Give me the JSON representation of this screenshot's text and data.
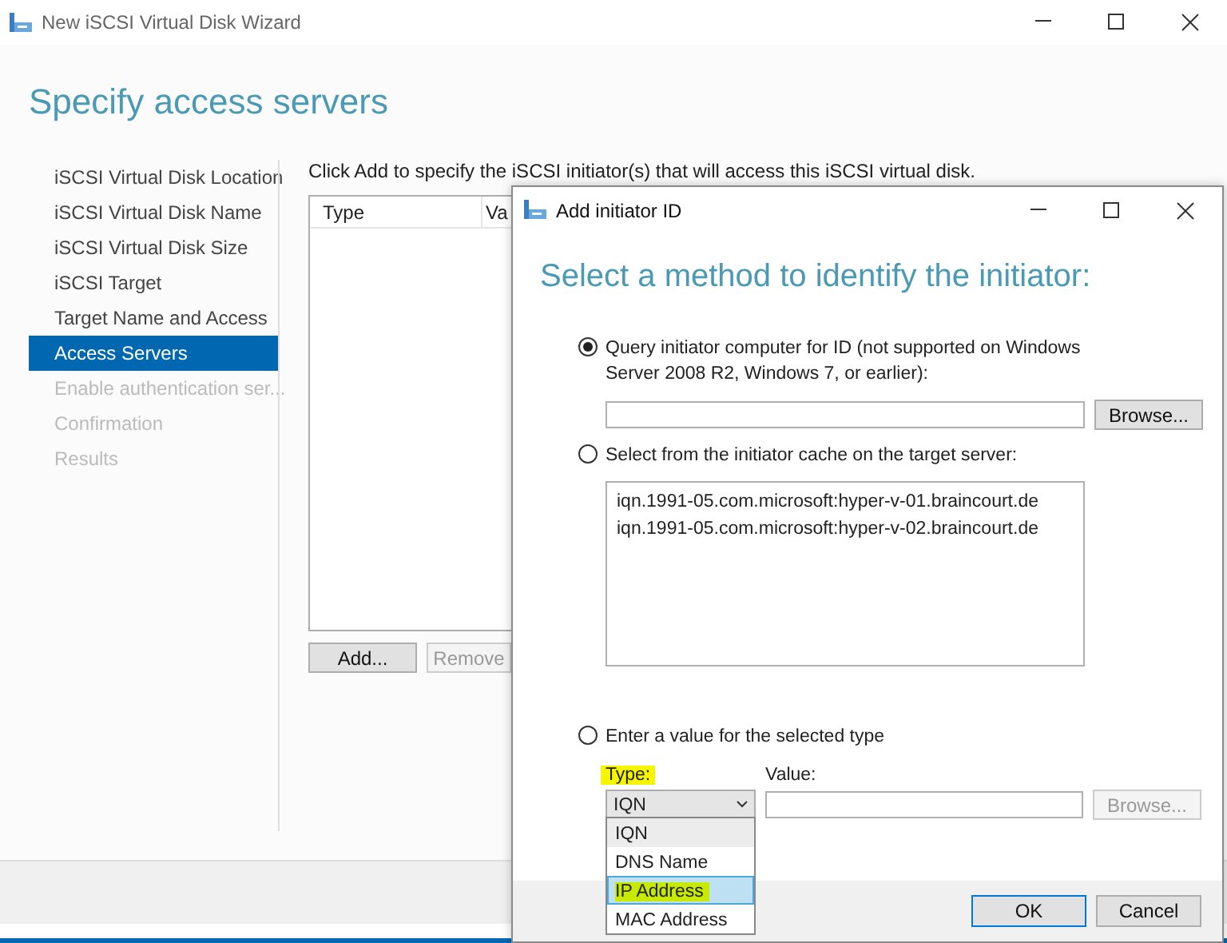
{
  "wizard": {
    "title": "New iSCSI Virtual Disk Wizard",
    "heading": "Specify access servers",
    "steps": [
      {
        "label": "iSCSI Virtual Disk Location",
        "selected": false,
        "disabled": false
      },
      {
        "label": "iSCSI Virtual Disk Name",
        "selected": false,
        "disabled": false
      },
      {
        "label": "iSCSI Virtual Disk Size",
        "selected": false,
        "disabled": false
      },
      {
        "label": "iSCSI Target",
        "selected": false,
        "disabled": false
      },
      {
        "label": "Target Name and Access",
        "selected": false,
        "disabled": false
      },
      {
        "label": "Access Servers",
        "selected": true,
        "disabled": false
      },
      {
        "label": "Enable authentication ser...",
        "selected": false,
        "disabled": true
      },
      {
        "label": "Confirmation",
        "selected": false,
        "disabled": true
      },
      {
        "label": "Results",
        "selected": false,
        "disabled": true
      }
    ],
    "instruction": "Click Add to specify the iSCSI initiator(s) that will access this iSCSI virtual disk.",
    "table": {
      "columns": [
        "Type",
        "Va"
      ]
    },
    "buttons": [
      {
        "label": "Add...",
        "disabled": false
      },
      {
        "label": "Remove",
        "disabled": true
      }
    ]
  },
  "dialog": {
    "title": "Add initiator ID",
    "heading": "Select a method to identify the initiator:",
    "options": [
      {
        "kind": "query",
        "label": "Query initiator computer for ID (not supported on Windows Server 2008 R2, Windows 7, or earlier):",
        "selected": true,
        "browse": {
          "label": "Browse...",
          "disabled": false
        }
      },
      {
        "kind": "cache",
        "label": "Select from the initiator cache on the target server:",
        "selected": false,
        "items": [
          "iqn.1991-05.com.microsoft:hyper-v-01.braincourt.de",
          "iqn.1991-05.com.microsoft:hyper-v-02.braincourt.de"
        ]
      },
      {
        "kind": "value",
        "label": "Enter a value for the selected type",
        "selected": false,
        "type_label": {
          "text": "Type:",
          "highlighted": true
        },
        "value_label": "Value:",
        "type_value": "IQN",
        "browse": {
          "label": "Browse...",
          "disabled": true
        },
        "dropdown": [
          {
            "label": "IQN",
            "hovered": true,
            "selected": false,
            "highlighted": false
          },
          {
            "label": "DNS Name",
            "hovered": false,
            "selected": false,
            "highlighted": false
          },
          {
            "label": "IP Address",
            "hovered": false,
            "selected": true,
            "highlighted": true
          },
          {
            "label": "MAC Address",
            "hovered": false,
            "selected": false,
            "highlighted": false
          }
        ]
      }
    ],
    "buttons": [
      {
        "label": "OK",
        "default": true
      },
      {
        "label": "Cancel",
        "default": false
      }
    ]
  }
}
